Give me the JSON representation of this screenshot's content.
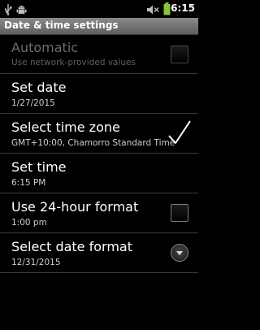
{
  "status_bar": {
    "time": "6:15",
    "icons": [
      "usb-icon",
      "android-debug-icon",
      "mute-icon",
      "battery-icon"
    ]
  },
  "window": {
    "title": "Date & time settings"
  },
  "settings": [
    {
      "title": "Automatic",
      "summary": "Use network-provided values",
      "control": "checkbox",
      "checked": false,
      "enabled": false
    },
    {
      "title": "Set date",
      "summary": "1/27/2015",
      "control": "none",
      "enabled": true
    },
    {
      "title": "Select time zone",
      "summary": "GMT+10:00, Chamorro Standard Time",
      "control": "checkmark",
      "enabled": true
    },
    {
      "title": "Set time",
      "summary": "6:15 PM",
      "control": "none",
      "enabled": true
    },
    {
      "title": "Use 24-hour format",
      "summary": "1:00 pm",
      "control": "checkbox",
      "checked": false,
      "enabled": true
    },
    {
      "title": "Select date format",
      "summary": "12/31/2015",
      "control": "dropdown",
      "enabled": true
    }
  ],
  "colors": {
    "background": "#000000",
    "title_bar": "#6e6e6e",
    "divider": "#3b3b3b",
    "disabled_text": "#6e6e6e"
  }
}
